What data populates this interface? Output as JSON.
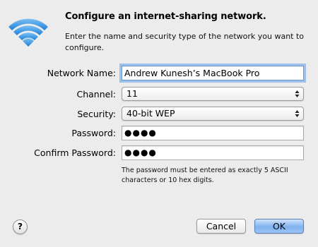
{
  "dialog": {
    "title": "Configure an internet-sharing network.",
    "description": "Enter the name and security type of the network you want to configure.",
    "icon": "wifi-icon",
    "accent_color": "#2f8be6"
  },
  "form": {
    "network_name": {
      "label": "Network Name:",
      "value": "Andrew Kunesh’s MacBook Pro"
    },
    "channel": {
      "label": "Channel:",
      "value": "11"
    },
    "security": {
      "label": "Security:",
      "value": "40-bit WEP"
    },
    "password": {
      "label": "Password:",
      "value": "●●●●"
    },
    "confirm_password": {
      "label": "Confirm Password:",
      "value": "●●●●"
    },
    "hint": "The password must be entered as exactly 5 ASCII characters or 10 hex digits."
  },
  "buttons": {
    "help": "?",
    "cancel": "Cancel",
    "ok": "OK"
  }
}
